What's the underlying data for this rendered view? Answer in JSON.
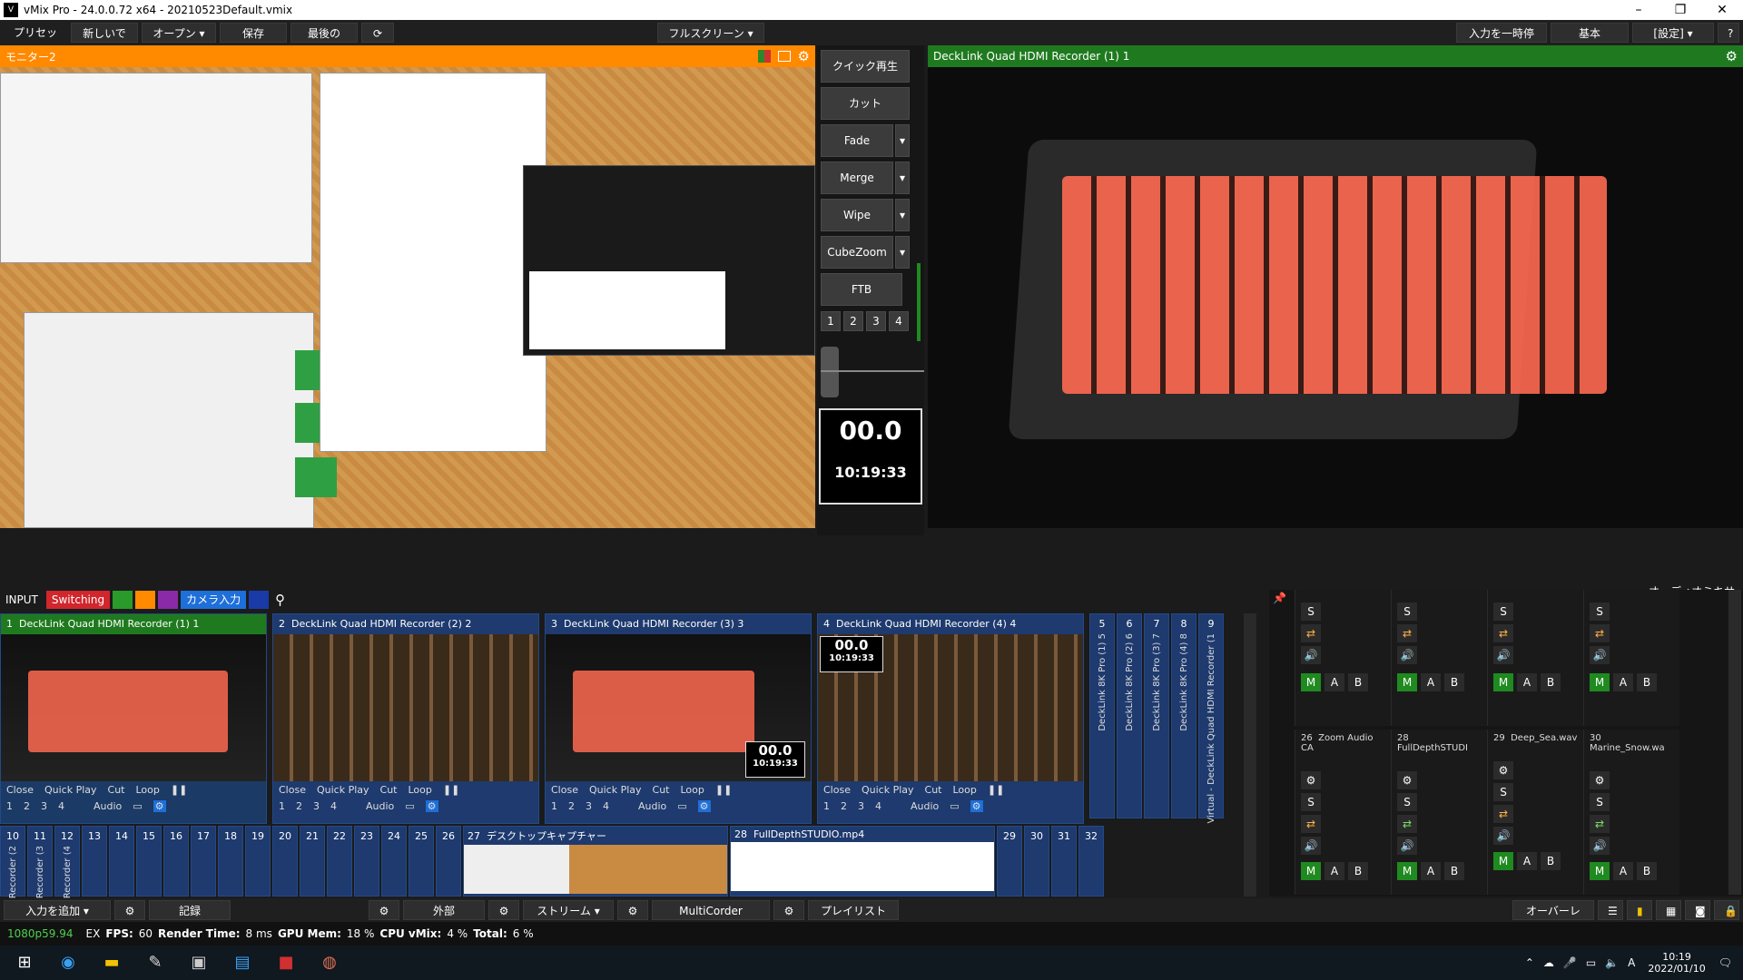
{
  "window": {
    "title": "vMix Pro - 24.0.0.72 x64 - 20210523Default.vmix"
  },
  "topbar": {
    "left": [
      "プリセット",
      "新しいです",
      "オープン",
      "保存",
      "最後の"
    ],
    "center": "フルスクリーン",
    "right": [
      "入力を一時停止",
      "基本",
      "[設定]",
      "?"
    ]
  },
  "preview": {
    "title": "モニター2"
  },
  "output": {
    "title": "DeckLink Quad HDMI Recorder (1) 1"
  },
  "transitions": {
    "quick_play": "クイック再生",
    "cut": "カット",
    "buttons": [
      "Fade",
      "Merge",
      "Wipe",
      "CubeZoom"
    ],
    "ftb": "FTB",
    "slots": [
      "1",
      "2",
      "3",
      "4"
    ],
    "timer": "00.0",
    "clock": "10:19:33"
  },
  "inputbar": {
    "input": "INPUT",
    "switching": "Switching",
    "camera": "カメラ入力",
    "audio_mixer": "オーディオミキサー"
  },
  "tiles": [
    {
      "num": "1",
      "name": "DeckLink Quad HDMI Recorder (1) 1",
      "active": true
    },
    {
      "num": "2",
      "name": "DeckLink Quad HDMI Recorder (2) 2",
      "active": false
    },
    {
      "num": "3",
      "name": "DeckLink Quad HDMI Recorder (3) 3",
      "active": false,
      "timer": "00.0",
      "clock": "10:19:33"
    },
    {
      "num": "4",
      "name": "DeckLink Quad HDMI Recorder (4) 4",
      "active": false,
      "timer": "00.0",
      "clock": "10:19:33"
    }
  ],
  "tile_controls": [
    "Close",
    "Quick Play",
    "Cut",
    "Loop"
  ],
  "tile_slots": [
    "1",
    "2",
    "3",
    "4",
    "Audio"
  ],
  "small_tiles_top": [
    {
      "num": "5",
      "label": "DeckLink 8K Pro (1) 5"
    },
    {
      "num": "6",
      "label": "DeckLink 8K Pro (2) 6"
    },
    {
      "num": "7",
      "label": "DeckLink 8K Pro (3) 7"
    },
    {
      "num": "8",
      "label": "DeckLink 8K Pro (4) 8"
    },
    {
      "num": "9",
      "label": "Virtual - DeckLink Quad HDMI Recorder (1"
    }
  ],
  "small_tiles_bottom": [
    {
      "num": "10",
      "label": "Recorder (2"
    },
    {
      "num": "11",
      "label": "Recorder (3"
    },
    {
      "num": "12",
      "label": "Recorder (4"
    },
    {
      "num": "13"
    },
    {
      "num": "14"
    },
    {
      "num": "15"
    },
    {
      "num": "16"
    },
    {
      "num": "17"
    },
    {
      "num": "18"
    },
    {
      "num": "19"
    },
    {
      "num": "20"
    },
    {
      "num": "21"
    },
    {
      "num": "22"
    },
    {
      "num": "23"
    },
    {
      "num": "24"
    },
    {
      "num": "25"
    },
    {
      "num": "26"
    }
  ],
  "wide_tiles": [
    {
      "num": "27",
      "name": "デスクトップキャプチャー"
    },
    {
      "num": "28",
      "name": "FullDepthSTUDIO.mp4"
    }
  ],
  "tail_tiles": [
    "29",
    "30",
    "31",
    "32"
  ],
  "audio_channels": [
    {
      "num": "26",
      "name": "Zoom Audio CA"
    },
    {
      "num": "28",
      "name": "FullDepthSTUDI"
    },
    {
      "num": "29",
      "name": "Deep_Sea.wav"
    },
    {
      "num": "30",
      "name": "Marine_Snow.wa"
    }
  ],
  "audio_buttons": {
    "m": "M",
    "a": "A",
    "b": "B",
    "s": "S"
  },
  "bottombar": {
    "add_input": "入力を追加",
    "record": "記録",
    "external": "外部",
    "stream": "ストリーム",
    "multicorder": "MultiCorder",
    "playlist": "プレイリスト",
    "overlay": "オーバーレイ"
  },
  "status": {
    "format": "1080p59.94",
    "ex": "EX",
    "fps_label": "FPS:",
    "fps": "60",
    "render_label": "Render Time:",
    "render": "8 ms",
    "gpu_label": "GPU Mem:",
    "gpu": "18 %",
    "cpu_label": "CPU vMix:",
    "cpu": "4 %",
    "total_label": "Total:",
    "total": "6 %"
  },
  "taskbar": {
    "time": "10:19",
    "date": "2022/01/10",
    "ime": "A"
  },
  "colors": {
    "accent_orange": "#ff8a00",
    "active_green": "#1f7a1f",
    "tile_blue": "#1e3a6e",
    "switching_red": "#d0262c",
    "camera_blue": "#1e6fd9"
  }
}
